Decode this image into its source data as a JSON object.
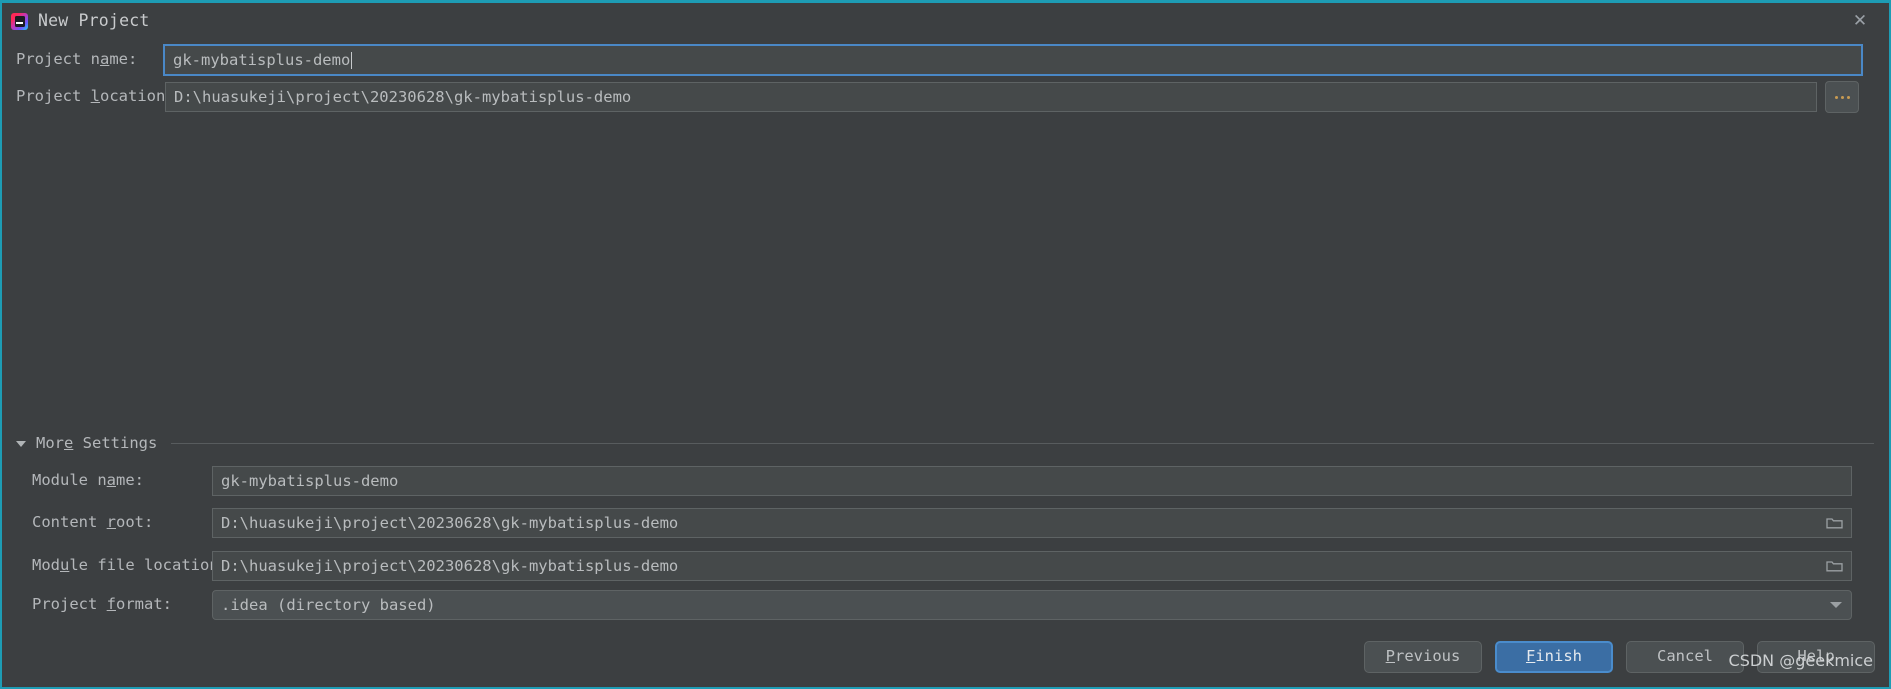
{
  "window": {
    "title": "New Project",
    "app_icon": "intellij-idea-icon",
    "close_icon": "close-icon",
    "accent_color": "#1d9cb4",
    "background_color": "#3c3f41"
  },
  "form": {
    "project_name": {
      "label_before": "Project n",
      "label_mnemonic": "a",
      "label_after": "me:",
      "value": "gk-mybatisplus-demo",
      "focused": true
    },
    "project_location": {
      "label_before": "Project ",
      "label_mnemonic": "l",
      "label_after": "ocation:",
      "value": "D:\\huasukeji\\project\\20230628\\gk-mybatisplus-demo",
      "browse_button": "...",
      "browse_icon": "ellipsis-icon"
    }
  },
  "more_settings": {
    "label_before": "Mor",
    "label_mnemonic": "e",
    "label_after": " Settings",
    "expanded": true,
    "collapse_icon": "chevron-down-icon",
    "fields": {
      "module_name": {
        "label_before": "Module n",
        "label_mnemonic": "a",
        "label_after": "me:",
        "value": "gk-mybatisplus-demo"
      },
      "content_root": {
        "label_before": "Content ",
        "label_mnemonic": "r",
        "label_after": "oot:",
        "value": "D:\\huasukeji\\project\\20230628\\gk-mybatisplus-demo",
        "browse_icon": "folder-icon"
      },
      "module_file_location": {
        "label_before": "Mod",
        "label_mnemonic": "u",
        "label_after": "le file location:",
        "value": "D:\\huasukeji\\project\\20230628\\gk-mybatisplus-demo",
        "browse_icon": "folder-icon"
      },
      "project_format": {
        "label_before": "Project ",
        "label_mnemonic": "f",
        "label_after": "ormat:",
        "value": ".idea (directory based)",
        "dropdown_icon": "chevron-down-icon"
      }
    }
  },
  "footer": {
    "buttons": [
      {
        "id": "previous",
        "before": "",
        "mnemonic": "P",
        "after": "revious",
        "primary": false
      },
      {
        "id": "finish",
        "before": "",
        "mnemonic": "F",
        "after": "inish",
        "primary": true
      },
      {
        "id": "cancel",
        "before": "Cancel",
        "mnemonic": "",
        "after": "",
        "primary": false
      },
      {
        "id": "help",
        "before": "Help",
        "mnemonic": "",
        "after": "",
        "primary": false
      }
    ],
    "watermark": "CSDN @geekmice"
  }
}
